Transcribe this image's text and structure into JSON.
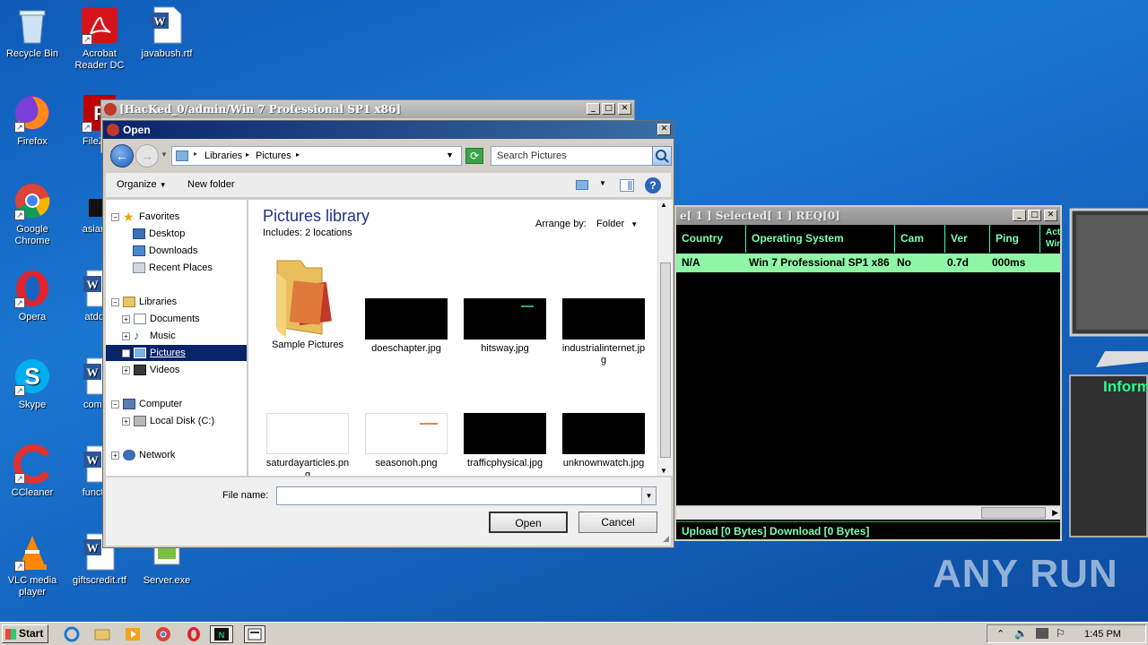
{
  "desktop": {
    "icons": [
      {
        "label": "Recycle Bin",
        "icon": "recycle-bin-icon"
      },
      {
        "label": "Acrobat Reader DC",
        "icon": "acrobat-icon"
      },
      {
        "label": "javabush.rtf",
        "icon": "word-doc-icon"
      },
      {
        "label": "Firefox",
        "icon": "firefox-icon"
      },
      {
        "label": "FileZilla",
        "icon": "filezilla-icon"
      },
      {
        "label": "Google Chrome",
        "icon": "chrome-icon"
      },
      {
        "label": "asianag",
        "icon": "file-icon"
      },
      {
        "label": "Opera",
        "icon": "opera-icon"
      },
      {
        "label": "atdocu",
        "icon": "word-doc-icon"
      },
      {
        "label": "Skype",
        "icon": "skype-icon"
      },
      {
        "label": "comput",
        "icon": "word-doc-icon"
      },
      {
        "label": "CCleaner",
        "icon": "ccleaner-icon"
      },
      {
        "label": "function",
        "icon": "word-doc-icon"
      },
      {
        "label": "VLC media player",
        "icon": "vlc-icon"
      },
      {
        "label": "giftscredit.rtf",
        "icon": "word-doc-icon"
      },
      {
        "label": "Server.exe",
        "icon": "exe-icon"
      }
    ]
  },
  "hacked_window": {
    "title": "[HacKed_0/admin/Win 7 Professional SP1 x86]"
  },
  "rat_window": {
    "title": "e[ 1 ]   Selected[ 1 ] REQ[0]",
    "columns": [
      "Country",
      "Operating System",
      "Cam",
      "Ver",
      "Ping",
      "Acti Win"
    ],
    "row": {
      "country": "N/A",
      "os": "Win 7 Professional SP1 x86",
      "cam": "No",
      "ver": "0.7d",
      "ping": "000ms"
    },
    "status": "Upload [0 Bytes]  Download [0 Bytes]"
  },
  "side_panel": {
    "info_label": "Inform"
  },
  "open_dialog": {
    "title": "Open",
    "breadcrumb": [
      "Libraries",
      "Pictures"
    ],
    "search_placeholder": "Search Pictures",
    "toolbar": {
      "organize": "Organize",
      "new_folder": "New folder"
    },
    "nav": {
      "favorites": "Favorites",
      "desktop": "Desktop",
      "downloads": "Downloads",
      "recent": "Recent Places",
      "libraries": "Libraries",
      "documents": "Documents",
      "music": "Music",
      "pictures": "Pictures",
      "videos": "Videos",
      "computer": "Computer",
      "local_disk": "Local Disk (C:)",
      "network": "Network"
    },
    "library_title": "Pictures library",
    "includes": "Includes:  2 locations",
    "arrange_label": "Arrange by:",
    "arrange_value": "Folder",
    "files": [
      {
        "name": "Sample Pictures",
        "kind": "folder"
      },
      {
        "name": "doeschapter.jpg",
        "kind": "dark"
      },
      {
        "name": "hitsway.jpg",
        "kind": "dark"
      },
      {
        "name": "industrialinternet.jpg",
        "kind": "dark"
      },
      {
        "name": "saturdayarticles.png",
        "kind": "white"
      },
      {
        "name": "seasonoh.png",
        "kind": "white"
      },
      {
        "name": "trafficphysical.jpg",
        "kind": "dark"
      },
      {
        "name": "unknownwatch.jpg",
        "kind": "dark"
      }
    ],
    "filename_label": "File name:",
    "filename_value": "",
    "open_button": "Open",
    "cancel_button": "Cancel"
  },
  "taskbar": {
    "start": "Start",
    "clock": "1:45 PM"
  },
  "watermark": "ANY RUN"
}
